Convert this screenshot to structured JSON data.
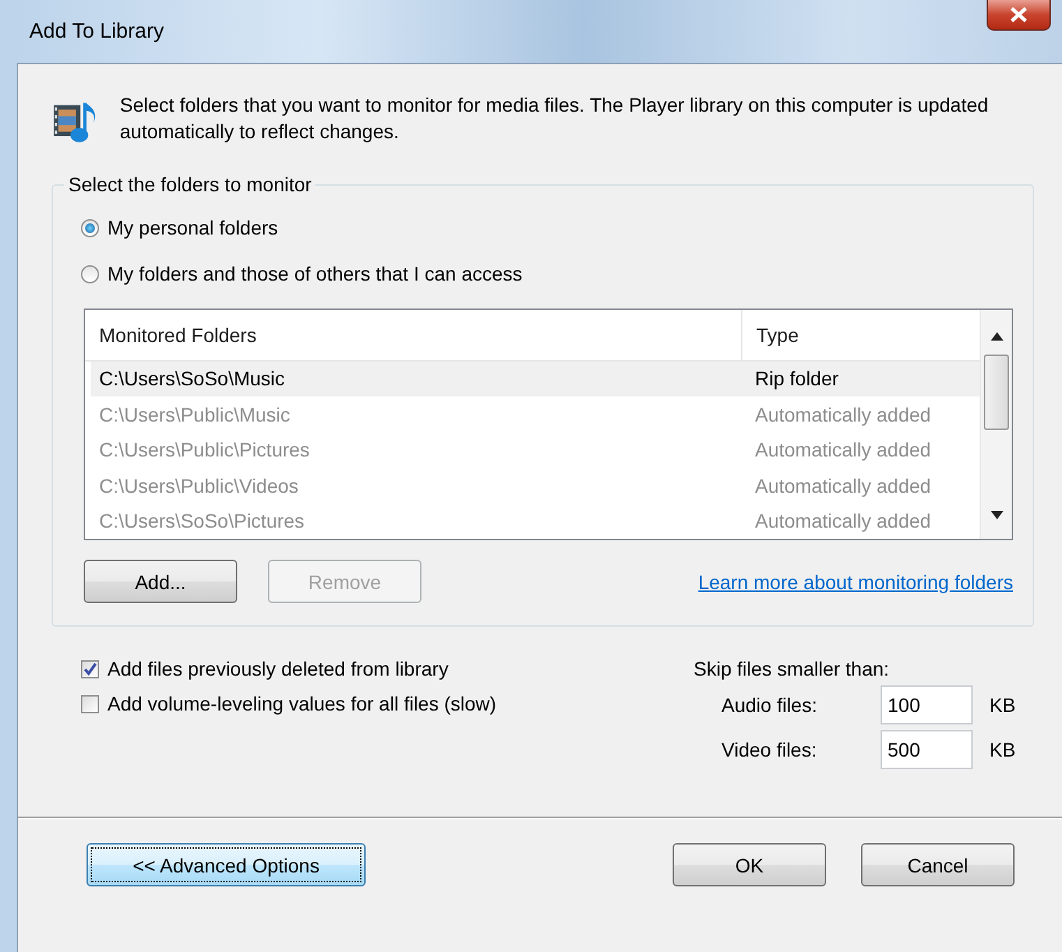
{
  "window": {
    "title": "Add To Library"
  },
  "intro": "Select folders that you want to monitor for media files. The Player library on this computer is updated automatically to reflect changes.",
  "group": {
    "title": "Select the folders to monitor",
    "options": [
      {
        "label": "My personal folders",
        "selected": true
      },
      {
        "label": "My folders and those of others that I can access",
        "selected": false
      }
    ],
    "list": {
      "columns": [
        "Monitored Folders",
        "Type"
      ],
      "rows": [
        {
          "folder": "C:\\Users\\SoSo\\Music",
          "type": "Rip folder",
          "selected": true,
          "dimmed": false
        },
        {
          "folder": "C:\\Users\\Public\\Music",
          "type": "Automatically added",
          "selected": false,
          "dimmed": true
        },
        {
          "folder": "C:\\Users\\Public\\Pictures",
          "type": "Automatically added",
          "selected": false,
          "dimmed": true
        },
        {
          "folder": "C:\\Users\\Public\\Videos",
          "type": "Automatically added",
          "selected": false,
          "dimmed": true
        },
        {
          "folder": "C:\\Users\\SoSo\\Pictures",
          "type": "Automatically added",
          "selected": false,
          "dimmed": true
        }
      ]
    },
    "buttons": [
      {
        "label": "Add...",
        "disabled": false
      },
      {
        "label": "Remove",
        "disabled": true
      }
    ],
    "link": "Learn more about monitoring folders"
  },
  "checks": [
    {
      "label": "Add files previously deleted from library",
      "checked": true
    },
    {
      "label": "Add volume-leveling values for all files (slow)",
      "checked": false
    }
  ],
  "skip": {
    "title": "Skip files smaller than:",
    "fields": [
      {
        "label": "Audio files:",
        "value": "100",
        "unit": "KB"
      },
      {
        "label": "Video files:",
        "value": "500",
        "unit": "KB"
      }
    ]
  },
  "footer": {
    "advanced": {
      "label": "<< Advanced Options",
      "focused": true
    },
    "buttons": [
      {
        "label": "OK"
      },
      {
        "label": "Cancel"
      }
    ]
  }
}
